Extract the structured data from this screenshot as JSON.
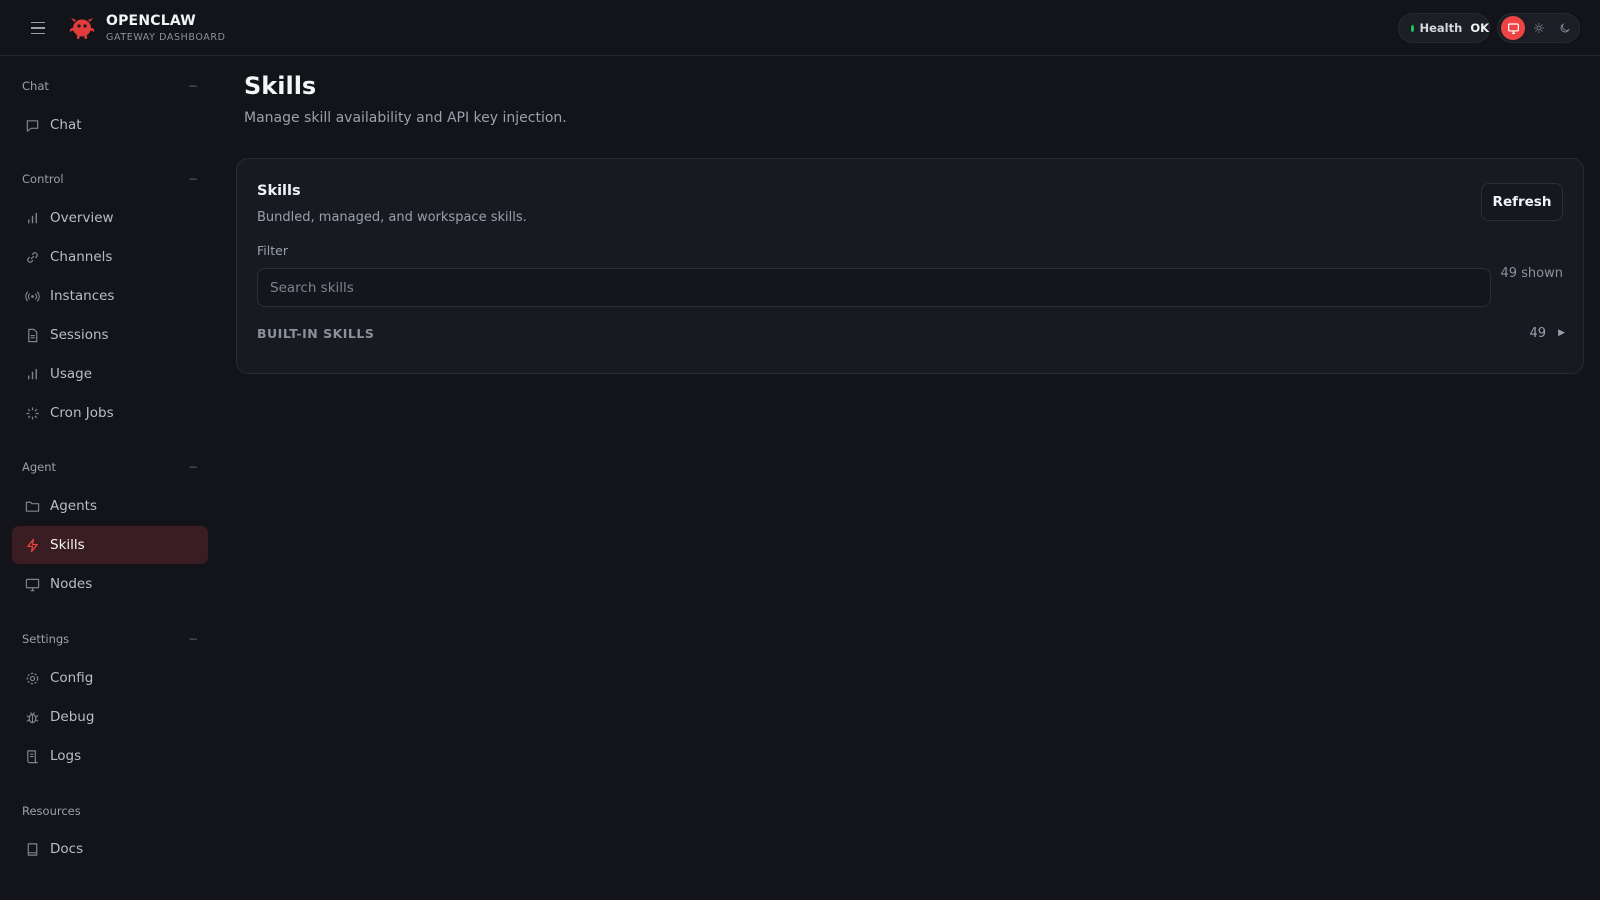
{
  "brand": {
    "name": "OPENCLAW",
    "subtitle": "GATEWAY DASHBOARD",
    "accent": "#ef4444"
  },
  "header": {
    "health_label": "Health",
    "health_value": "OK",
    "health_color": "#22c55e",
    "theme_modes": [
      "monitor-icon",
      "sun-icon",
      "moon-icon"
    ]
  },
  "sidebar": {
    "sections": [
      {
        "title": "Chat",
        "collapse": "−",
        "items": [
          {
            "label": "Chat",
            "icon": "chat-bubble-icon"
          }
        ]
      },
      {
        "title": "Control",
        "collapse": "−",
        "items": [
          {
            "label": "Overview",
            "icon": "bar-chart-icon"
          },
          {
            "label": "Channels",
            "icon": "link-icon"
          },
          {
            "label": "Instances",
            "icon": "radio-icon"
          },
          {
            "label": "Sessions",
            "icon": "document-icon"
          },
          {
            "label": "Usage",
            "icon": "bar-chart-icon"
          },
          {
            "label": "Cron Jobs",
            "icon": "loader-icon"
          }
        ]
      },
      {
        "title": "Agent",
        "collapse": "−",
        "items": [
          {
            "label": "Agents",
            "icon": "folder-icon"
          },
          {
            "label": "Skills",
            "icon": "lightning-icon",
            "active": true
          },
          {
            "label": "Nodes",
            "icon": "monitor-icon"
          }
        ]
      },
      {
        "title": "Settings",
        "collapse": "−",
        "items": [
          {
            "label": "Config",
            "icon": "gear-icon"
          },
          {
            "label": "Debug",
            "icon": "bug-icon"
          },
          {
            "label": "Logs",
            "icon": "scroll-icon"
          }
        ]
      },
      {
        "title": "Resources",
        "items": [
          {
            "label": "Docs",
            "icon": "book-icon"
          }
        ]
      }
    ]
  },
  "page": {
    "title": "Skills",
    "subtitle": "Manage skill availability and API key injection."
  },
  "card": {
    "title": "Skills",
    "subtitle": "Bundled, managed, and workspace skills.",
    "refresh_label": "Refresh",
    "filter_label": "Filter",
    "search_placeholder": "Search skills",
    "search_value": "",
    "shown_text": "49 shown",
    "group": {
      "label": "BUILT-IN SKILLS",
      "count": "49",
      "arrow": "▶"
    }
  }
}
